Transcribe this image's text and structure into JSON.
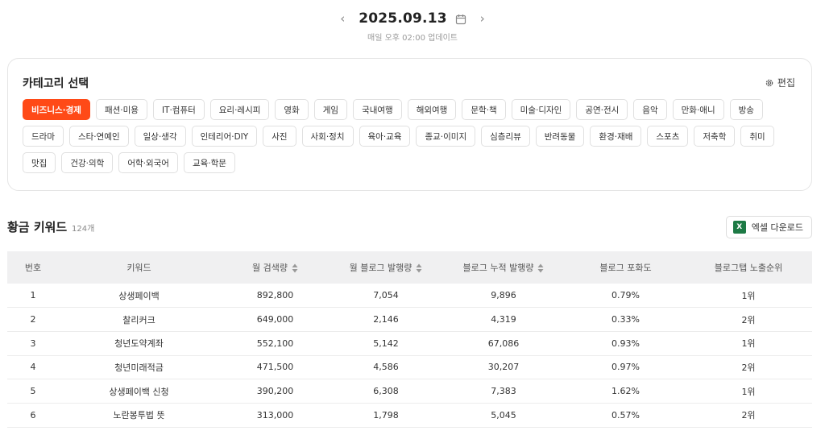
{
  "date_nav": {
    "prev_icon": "chevron-left-icon",
    "date": "2025.09.13",
    "calendar_icon": "calendar-icon",
    "next_icon": "chevron-right-icon",
    "update_note": "매일 오후 02:00 업데이트"
  },
  "category": {
    "title": "카테고리 선택",
    "edit_label": "편집",
    "edit_icon": "gear-icon",
    "accent_color": "#ff4a17",
    "selected": "비즈니스·경제",
    "chips": [
      "비즈니스·경제",
      "패션·미용",
      "IT·컴퓨터",
      "요리·레시피",
      "영화",
      "게임",
      "국내여행",
      "해외여행",
      "문학·책",
      "미술·디자인",
      "공연·전시",
      "음악",
      "만화·애니",
      "방송",
      "드라마",
      "스타·연예인",
      "일상·생각",
      "인테리어·DIY",
      "사진",
      "사회·정치",
      "육아·교육",
      "종교·이미지",
      "심층리뷰",
      "반려동물",
      "환경·재배",
      "스포츠",
      "저축학",
      "취미",
      "맛집",
      "건강·의학",
      "어학·외국어",
      "교육·학문"
    ]
  },
  "keywords": {
    "title": "황금 키워드",
    "count": "124개",
    "excel_label": "엑셀 다운로드",
    "excel_icon": "excel-icon",
    "columns": [
      "번호",
      "키워드",
      "월 검색량",
      "월 블로그 발행량",
      "블로그 누적 발행량",
      "블로그 포화도",
      "블로그탭 노출순위"
    ],
    "sortable": [
      false,
      false,
      true,
      true,
      true,
      false,
      false
    ],
    "rows": [
      [
        "1",
        "상생페이백",
        "892,800",
        "7,054",
        "9,896",
        "0.79%",
        "1위"
      ],
      [
        "2",
        "찰리커크",
        "649,000",
        "2,146",
        "4,319",
        "0.33%",
        "2위"
      ],
      [
        "3",
        "청년도약계좌",
        "552,100",
        "5,142",
        "67,086",
        "0.93%",
        "1위"
      ],
      [
        "4",
        "청년미래적금",
        "471,500",
        "4,586",
        "30,207",
        "0.97%",
        "2위"
      ],
      [
        "5",
        "상생페이백 신청",
        "390,200",
        "6,308",
        "7,383",
        "1.62%",
        "1위"
      ],
      [
        "6",
        "노란봉투법 뜻",
        "313,000",
        "1,798",
        "5,045",
        "0.57%",
        "2위"
      ]
    ]
  }
}
